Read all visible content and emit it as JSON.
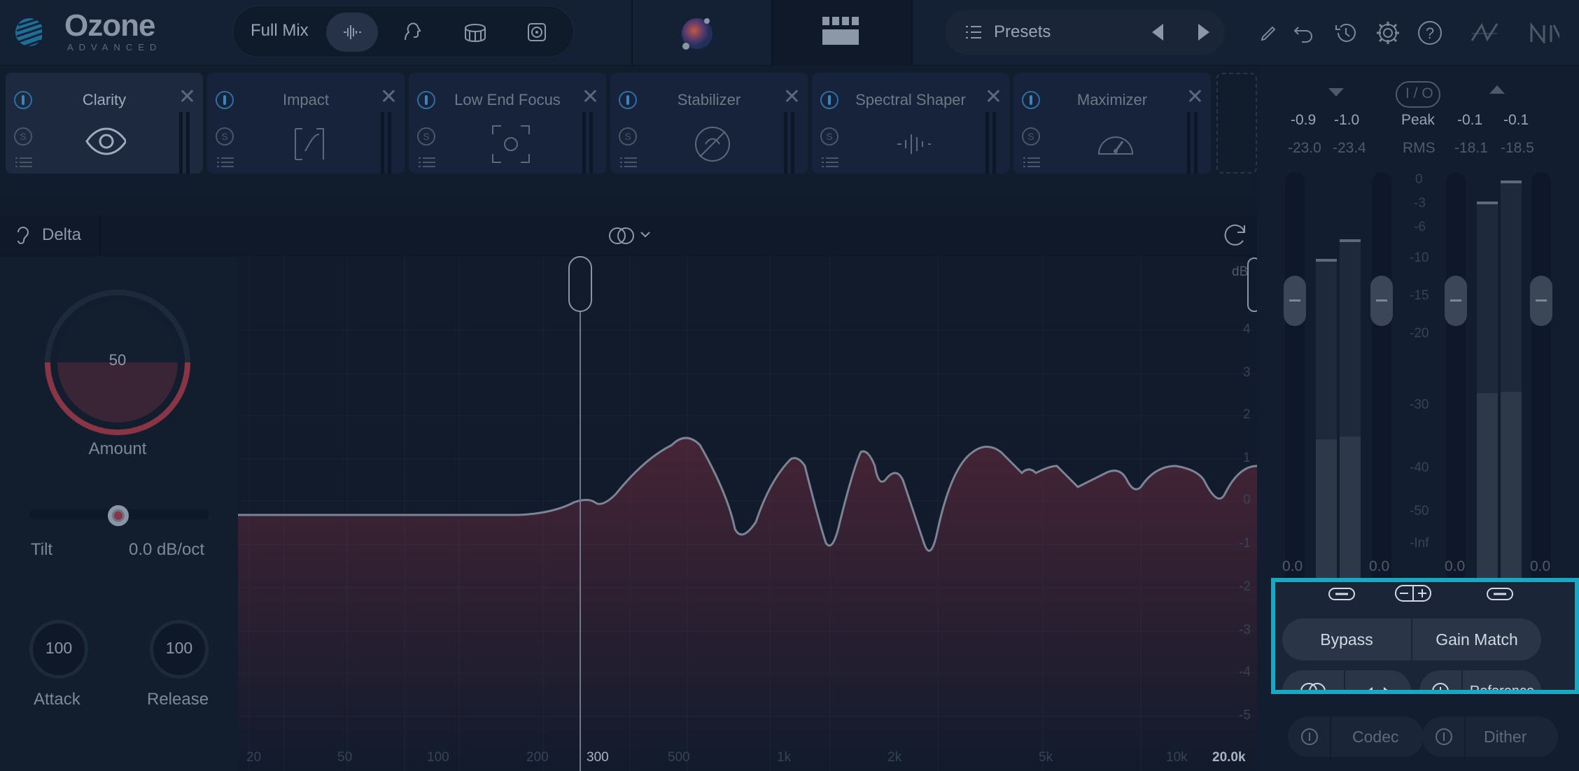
{
  "app": {
    "logo_title": "Ozone",
    "logo_subtitle": "ADVANCED"
  },
  "toolbar": {
    "mix_label": "Full Mix",
    "mix_buttons": [
      "waveform-icon",
      "vocal-icon",
      "drum-icon",
      "speaker-icon"
    ],
    "presets_label": "Presets",
    "icons": [
      "pencil-icon",
      "undo-icon",
      "history-icon",
      "gear-icon",
      "help-icon",
      "eq-curve-icon",
      "ni-logo-icon"
    ]
  },
  "modules": [
    {
      "name": "Clarity",
      "icon": "eye-icon",
      "active": true
    },
    {
      "name": "Impact",
      "icon": "impact-icon",
      "active": false
    },
    {
      "name": "Low End Focus",
      "icon": "focus-icon",
      "active": false
    },
    {
      "name": "Stabilizer",
      "icon": "stabilizer-icon",
      "active": false
    },
    {
      "name": "Spectral Shaper",
      "icon": "shaper-icon",
      "active": false
    },
    {
      "name": "Maximizer",
      "icon": "gauge-icon",
      "active": false
    }
  ],
  "delta": {
    "label": "Delta"
  },
  "controls": {
    "amount_value": "50",
    "amount_label": "Amount",
    "amount_fraction": 0.5,
    "tilt_label": "Tilt",
    "tilt_value": "0.0 dB/oct",
    "attack_value": "100",
    "attack_label": "Attack",
    "release_value": "100",
    "release_label": "Release"
  },
  "graph": {
    "unit_label": "dB",
    "y_ticks": [
      "4",
      "3",
      "2",
      "1",
      "0",
      "-1",
      "-2",
      "-3",
      "-4",
      "-5"
    ],
    "x_ticks": [
      "20",
      "50",
      "100",
      "200",
      "300",
      "500",
      "1k",
      "2k",
      "5k",
      "10k",
      "20.0k"
    ],
    "selected_freq": "300"
  },
  "meters": {
    "in_peak_l": "-0.9",
    "in_peak_r": "-1.0",
    "peak_label": "Peak",
    "out_peak_l": "-0.1",
    "out_peak_r": "-0.1",
    "in_rms_l": "-23.0",
    "in_rms_r": "-23.4",
    "rms_label": "RMS",
    "out_rms_l": "-18.1",
    "out_rms_r": "-18.5",
    "io_label": "I / O",
    "scale": [
      "0",
      "-3",
      "-6",
      "-10",
      "-15",
      "-20",
      "-30",
      "-40",
      "-50",
      "-Inf"
    ],
    "gain_in_l": "0.0",
    "gain_in_r": "0.0",
    "gain_out_l": "0.0",
    "gain_out_r": "0.0"
  },
  "bottom": {
    "bypass_label": "Bypass",
    "gain_match_label": "Gain Match",
    "reference_label": "Reference",
    "codec_label": "Codec",
    "dither_label": "Dither"
  },
  "colors": {
    "highlight": "#17a9c4",
    "accent_red": "#8a3545",
    "power_blue": "#3a85bd"
  }
}
